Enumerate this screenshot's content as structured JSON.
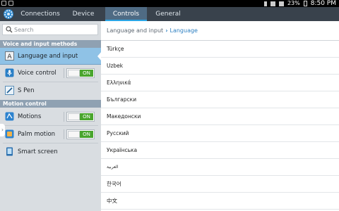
{
  "status_bar": {
    "battery": "23%",
    "time": "8:50 PM"
  },
  "tabs": [
    {
      "label": "Connections"
    },
    {
      "label": "Device"
    },
    {
      "label": "Controls"
    },
    {
      "label": "General"
    }
  ],
  "sidebar": {
    "search_placeholder": "Search",
    "sections": [
      {
        "title": "Voice and input methods"
      },
      {
        "title": "Motion control"
      }
    ],
    "items": [
      {
        "label": "Language and input",
        "icon": "keyboard-letter-icon"
      },
      {
        "label": "Voice control",
        "icon": "microphone-icon",
        "toggle": "ON"
      },
      {
        "label": "S Pen",
        "icon": "pen-icon"
      },
      {
        "label": "Motions",
        "icon": "motion-icon",
        "toggle": "ON"
      },
      {
        "label": "Palm motion",
        "icon": "palm-icon",
        "toggle": "ON"
      },
      {
        "label": "Smart screen",
        "icon": "smart-screen-icon"
      }
    ]
  },
  "breadcrumb": {
    "parent": "Language and input",
    "current": "Language"
  },
  "languages": [
    "Türkçe",
    "Uzbek",
    "Ελληνικά",
    "Български",
    "Македонски",
    "Русский",
    "Українська",
    "العربية",
    "한국어",
    "中文"
  ],
  "colors": {
    "accent": "#2aa6e6",
    "toggle_on": "#49a52d",
    "tabbar": "#39424c"
  }
}
